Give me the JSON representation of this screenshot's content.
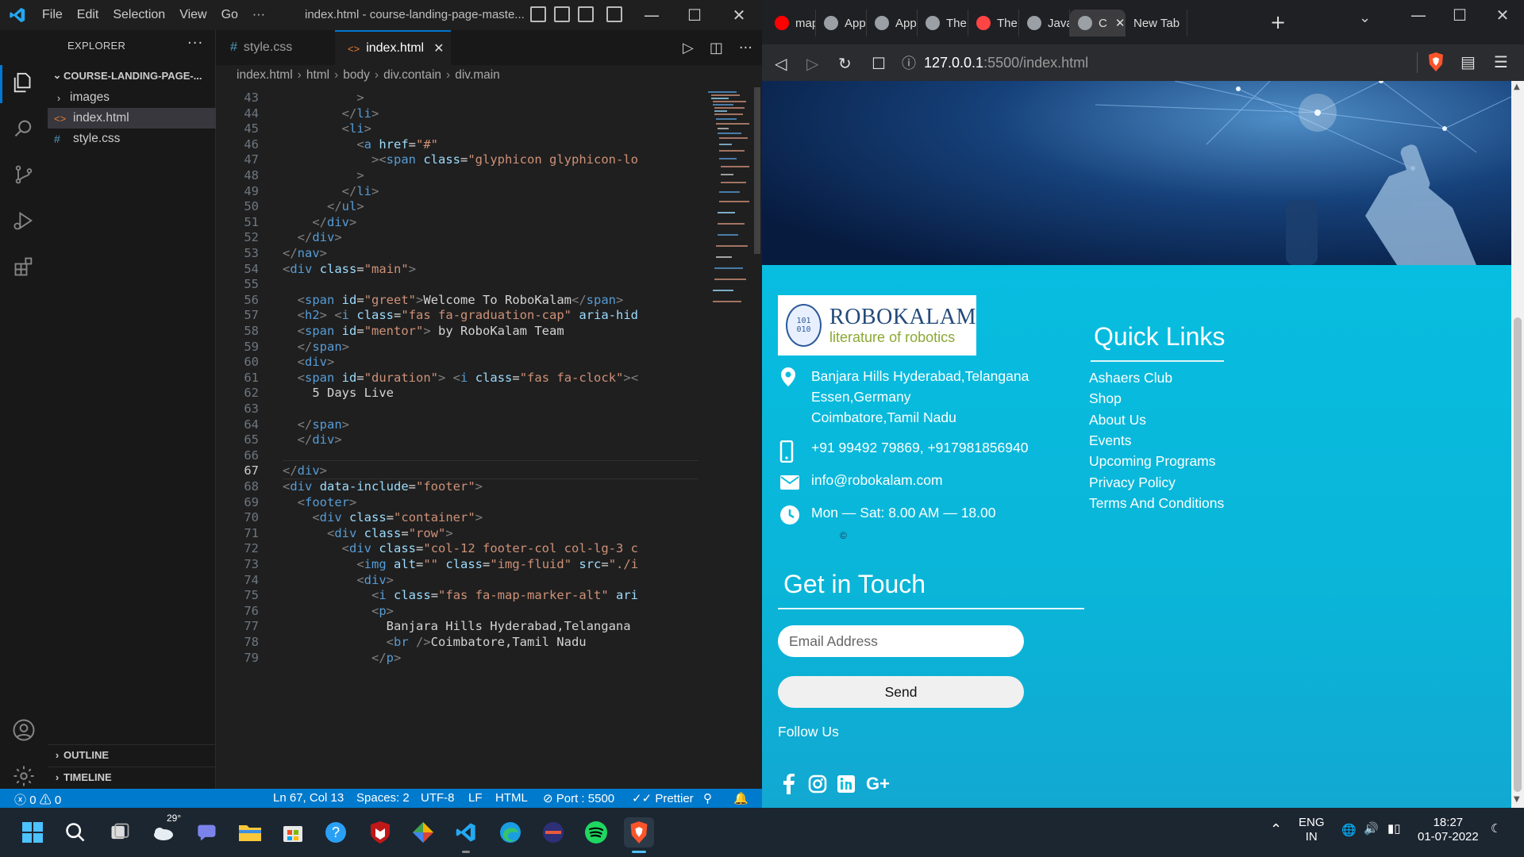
{
  "vscode": {
    "menu": [
      "File",
      "Edit",
      "Selection",
      "View",
      "Go",
      "···"
    ],
    "title": "index.html - course-landing-page-maste...",
    "explorer_header": "EXPLORER",
    "project_name": "COURSE-LANDING-PAGE-...",
    "tree": [
      {
        "label": "images",
        "kind": "folder"
      },
      {
        "label": "index.html",
        "kind": "html"
      },
      {
        "label": "style.css",
        "kind": "css"
      }
    ],
    "outline": "OUTLINE",
    "timeline": "TIMELINE",
    "tabs": [
      {
        "label": "style.css",
        "icon": "#"
      },
      {
        "label": "index.html",
        "icon": "<>"
      }
    ],
    "breadcrumb": [
      "index.html",
      "html",
      "body",
      "div.contain",
      "div.main"
    ],
    "code_lines": [
      {
        "n": "43",
        "html": "<span class='t-punc'>          &gt;</span>"
      },
      {
        "n": "44",
        "html": "<span class='t-punc'>        &lt;/</span><span class='t-tag'>li</span><span class='t-punc'>&gt;</span>"
      },
      {
        "n": "45",
        "html": "<span class='t-punc'>        &lt;</span><span class='t-tag'>li</span><span class='t-punc'>&gt;</span>"
      },
      {
        "n": "46",
        "html": "<span class='t-punc'>          &lt;</span><span class='t-tag'>a</span> <span class='t-attr'>href</span><span class='t-text'>=</span><span class='t-str'>\"#\"</span>"
      },
      {
        "n": "47",
        "html": "<span class='t-punc'>            &gt;&lt;</span><span class='t-tag'>span</span> <span class='t-attr'>class</span><span class='t-text'>=</span><span class='t-str'>\"glyphicon glyphicon-lo</span>"
      },
      {
        "n": "48",
        "html": "<span class='t-punc'>          &gt;</span>"
      },
      {
        "n": "49",
        "html": "<span class='t-punc'>        &lt;/</span><span class='t-tag'>li</span><span class='t-punc'>&gt;</span>"
      },
      {
        "n": "50",
        "html": "<span class='t-punc'>      &lt;/</span><span class='t-tag'>ul</span><span class='t-punc'>&gt;</span>"
      },
      {
        "n": "51",
        "html": "<span class='t-punc'>    &lt;/</span><span class='t-tag'>div</span><span class='t-punc'>&gt;</span>"
      },
      {
        "n": "52",
        "html": "<span class='t-punc'>  &lt;/</span><span class='t-tag'>div</span><span class='t-punc'>&gt;</span>"
      },
      {
        "n": "53",
        "html": "<span class='t-punc'>&lt;/</span><span class='t-tag'>nav</span><span class='t-punc'>&gt;</span>"
      },
      {
        "n": "54",
        "html": "<span class='t-punc'>&lt;</span><span class='t-tag'>div</span> <span class='t-attr'>class</span><span class='t-text'>=</span><span class='t-str'>\"main\"</span><span class='t-punc'>&gt;</span>"
      },
      {
        "n": "55",
        "html": ""
      },
      {
        "n": "56",
        "html": "<span class='t-punc'>  &lt;</span><span class='t-tag'>span</span> <span class='t-attr'>id</span><span class='t-text'>=</span><span class='t-str'>\"greet\"</span><span class='t-punc'>&gt;</span><span class='t-text'>Welcome To RoboKalam</span><span class='t-punc'>&lt;/</span><span class='t-tag'>span</span><span class='t-punc'>&gt;</span>"
      },
      {
        "n": "57",
        "html": "<span class='t-punc'>  &lt;</span><span class='t-tag'>h2</span><span class='t-punc'>&gt; &lt;</span><span class='t-tag'>i</span> <span class='t-attr'>class</span><span class='t-text'>=</span><span class='t-str'>\"fas fa-graduation-cap\"</span> <span class='t-attr'>aria-hid</span>"
      },
      {
        "n": "58",
        "html": "<span class='t-punc'>  &lt;</span><span class='t-tag'>span</span> <span class='t-attr'>id</span><span class='t-text'>=</span><span class='t-str'>\"mentor\"</span><span class='t-punc'>&gt;</span><span class='t-text'> by RoboKalam Team</span>"
      },
      {
        "n": "59",
        "html": "<span class='t-punc'>  &lt;/</span><span class='t-tag'>span</span><span class='t-punc'>&gt;</span>"
      },
      {
        "n": "60",
        "html": "<span class='t-punc'>  &lt;</span><span class='t-tag'>div</span><span class='t-punc'>&gt;</span>"
      },
      {
        "n": "61",
        "html": "<span class='t-punc'>  &lt;</span><span class='t-tag'>span</span> <span class='t-attr'>id</span><span class='t-text'>=</span><span class='t-str'>\"duration\"</span><span class='t-punc'>&gt; &lt;</span><span class='t-tag'>i</span> <span class='t-attr'>class</span><span class='t-text'>=</span><span class='t-str'>\"fas fa-clock\"</span><span class='t-punc'>&gt;&lt;</span>"
      },
      {
        "n": "62",
        "html": "<span class='t-text'>    5 Days Live</span>"
      },
      {
        "n": "63",
        "html": ""
      },
      {
        "n": "64",
        "html": "<span class='t-punc'>  &lt;/</span><span class='t-tag'>span</span><span class='t-punc'>&gt;</span>"
      },
      {
        "n": "65",
        "html": "<span class='t-punc'>  &lt;/</span><span class='t-tag'>div</span><span class='t-punc'>&gt;</span>"
      },
      {
        "n": "66",
        "html": ""
      },
      {
        "n": "67",
        "html": "<span class='t-punc'>&lt;/</span><span class='t-tag'>div</span><span class='t-punc'>&gt;</span>"
      },
      {
        "n": "68",
        "html": "<span class='t-punc'>&lt;</span><span class='t-tag'>div</span> <span class='t-attr'>data-include</span><span class='t-text'>=</span><span class='t-str'>\"footer\"</span><span class='t-punc'>&gt;</span>"
      },
      {
        "n": "69",
        "html": "<span class='t-punc'>  &lt;</span><span class='t-tag'>footer</span><span class='t-punc'>&gt;</span>"
      },
      {
        "n": "70",
        "html": "<span class='t-punc'>    &lt;</span><span class='t-tag'>div</span> <span class='t-attr'>class</span><span class='t-text'>=</span><span class='t-str'>\"container\"</span><span class='t-punc'>&gt;</span>"
      },
      {
        "n": "71",
        "html": "<span class='t-punc'>      &lt;</span><span class='t-tag'>div</span> <span class='t-attr'>class</span><span class='t-text'>=</span><span class='t-str'>\"row\"</span><span class='t-punc'>&gt;</span>"
      },
      {
        "n": "72",
        "html": "<span class='t-punc'>        &lt;</span><span class='t-tag'>div</span> <span class='t-attr'>class</span><span class='t-text'>=</span><span class='t-str'>\"col-12 footer-col col-lg-3 c</span>"
      },
      {
        "n": "73",
        "html": "<span class='t-punc'>          &lt;</span><span class='t-tag'>img</span> <span class='t-attr'>alt</span><span class='t-text'>=</span><span class='t-str'>\"\"</span> <span class='t-attr'>class</span><span class='t-text'>=</span><span class='t-str'>\"img-fluid\"</span> <span class='t-attr'>src</span><span class='t-text'>=</span><span class='t-str'>\"./i</span>"
      },
      {
        "n": "74",
        "html": "<span class='t-punc'>          &lt;</span><span class='t-tag'>div</span><span class='t-punc'>&gt;</span>"
      },
      {
        "n": "75",
        "html": "<span class='t-punc'>            &lt;</span><span class='t-tag'>i</span> <span class='t-attr'>class</span><span class='t-text'>=</span><span class='t-str'>\"fas fa-map-marker-alt\"</span> <span class='t-attr'>ari</span>"
      },
      {
        "n": "76",
        "html": "<span class='t-punc'>            &lt;</span><span class='t-tag'>p</span><span class='t-punc'>&gt;</span>"
      },
      {
        "n": "77",
        "html": "<span class='t-text'>              Banjara Hills Hyderabad,Telangana</span>"
      },
      {
        "n": "78",
        "html": "<span class='t-punc'>              &lt;</span><span class='t-tag'>br</span> <span class='t-punc'>/&gt;</span><span class='t-text'>Coimbatore,Tamil Nadu</span>"
      },
      {
        "n": "79",
        "html": "<span class='t-punc'>            &lt;/</span><span class='t-tag'>p</span><span class='t-punc'>&gt;</span>"
      }
    ],
    "current_line": "67",
    "status": {
      "errors": "0",
      "warnings": "0",
      "position": "Ln 67, Col 13",
      "spaces": "Spaces: 2",
      "encoding": "UTF-8",
      "eol": "LF",
      "language": "HTML",
      "port": "Port : 5500",
      "prettier": "Prettier"
    }
  },
  "browser": {
    "tabs": [
      {
        "label": "map.",
        "color": "#ff0000"
      },
      {
        "label": "Appl",
        "color": "#9aa0a6"
      },
      {
        "label": "Appl",
        "color": "#9aa0a6"
      },
      {
        "label": "The r",
        "color": "#9aa0a6"
      },
      {
        "label": "The I",
        "color": "#ff4444"
      },
      {
        "label": "JavaS",
        "color": "#9aa0a6"
      },
      {
        "label": "C",
        "color": "#9aa0a6"
      },
      {
        "label": "New Tab",
        "color": ""
      }
    ],
    "url_host": "127.0.0.1",
    "url_path": ":5500/index.html",
    "page": {
      "logo_name": "ROBOKALAM",
      "logo_tagline": "literature of robotics",
      "address_lines": [
        "Banjara Hills Hyderabad,Telangana",
        "Essen,Germany",
        "Coimbatore,Tamil Nadu"
      ],
      "phone": "+91 99492 79869, +917981856940",
      "email": "info@robokalam.com",
      "hours": "Mon — Sat: 8.00 AM — 18.00",
      "copyright_symbol": "©",
      "quick_links_title": "Quick Links",
      "quick_links": [
        "Ashaers Club",
        "Shop",
        "About Us",
        "Events",
        "Upcoming Programs",
        "Privacy Policy",
        "Terms And Conditions"
      ],
      "get_in_touch_title": "Get in Touch",
      "email_placeholder": "Email Address",
      "send_label": "Send",
      "follow_us": "Follow Us",
      "social": [
        "facebook-icon",
        "instagram-icon",
        "linkedin-icon",
        "google-plus-icon"
      ]
    }
  },
  "taskbar": {
    "weather_temp": "29°",
    "lang_top": "ENG",
    "lang_bottom": "IN",
    "time": "18:27",
    "date": "01-07-2022"
  },
  "colors": {
    "vscode_accent": "#007acc",
    "footer_cyan": "#09bedc",
    "brave_orange": "#fb542b"
  }
}
